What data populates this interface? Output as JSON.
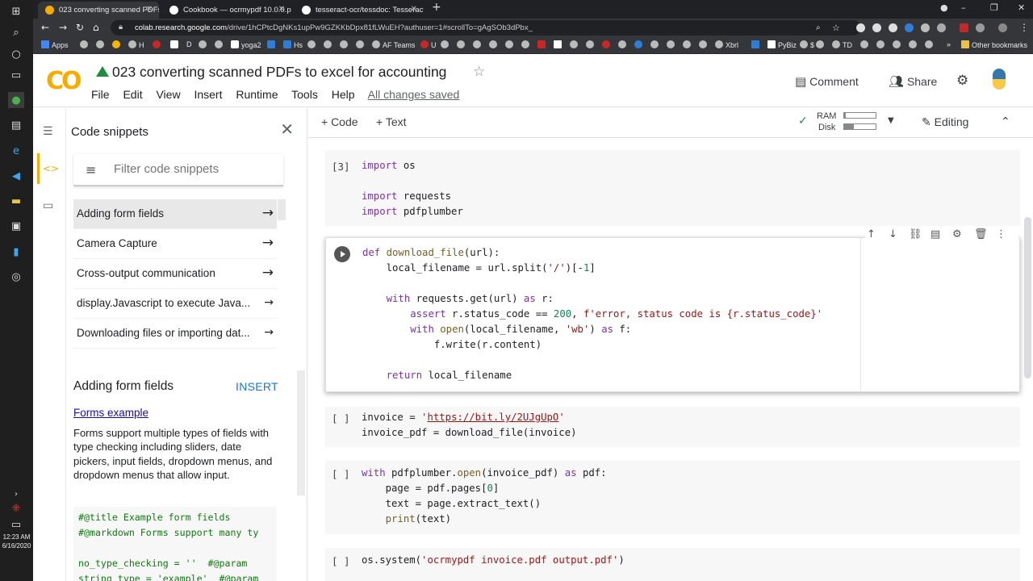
{
  "taskbar": {
    "clock_time": "12:23 AM",
    "clock_date": "6/16/2020"
  },
  "browser": {
    "tabs": [
      {
        "title": "023 converting scanned PDFs to"
      },
      {
        "title": "Cookbook — ocrmypdf 10.0.0.p"
      },
      {
        "title": "tesseract-ocr/tessdoc: Tesseract"
      }
    ],
    "url_host": "colab.research.google.com",
    "url_path": "/drive/1hCPtcDgNKs1upPw9GZKKbDpx81fLWuEH?authuser=1#scrollTo=gAgSOb3dPbx_",
    "bookmarks": [
      "Apps",
      "H",
      "D",
      "yoga2",
      "Hs",
      "AF Teams",
      "U",
      "Xbrl",
      "PyBiz",
      "$",
      "TD",
      "Other bookmarks"
    ]
  },
  "header": {
    "title": "023 converting scanned PDFs to excel for accounting",
    "menu": [
      "File",
      "Edit",
      "View",
      "Insert",
      "Runtime",
      "Tools",
      "Help"
    ],
    "saved": "All changes saved",
    "comment": "Comment",
    "share": "Share"
  },
  "sidebar": {
    "title": "Code snippets",
    "filter_placeholder": "Filter code snippets",
    "items": [
      "Adding form fields",
      "Camera Capture",
      "Cross-output communication",
      "display.Javascript to execute Java...",
      "Downloading files or importing dat..."
    ],
    "detail": {
      "title": "Adding form fields",
      "insert": "INSERT",
      "link": "Forms example",
      "description": "Forms support multiple types of fields with type checking including sliders, date pickers, input fields, dropdown menus, and dropdown menus that allow input.",
      "code": "#@title Example form fields\n#@markdown Forms support many ty\n\nno_type_checking = ''  #@param\nstring_type = 'example'  #@param"
    }
  },
  "notebook": {
    "add_code": "+ Code",
    "add_text": "+ Text",
    "ram": "RAM",
    "disk": "Disk",
    "editing": "Editing",
    "ram_used": 0.05,
    "disk_used": 0.3,
    "cells": [
      {
        "prompt": "[3]"
      },
      {
        "prompt": ""
      },
      {
        "prompt": "[ ]"
      },
      {
        "prompt": "[ ]"
      },
      {
        "prompt": "[ ]"
      }
    ]
  }
}
